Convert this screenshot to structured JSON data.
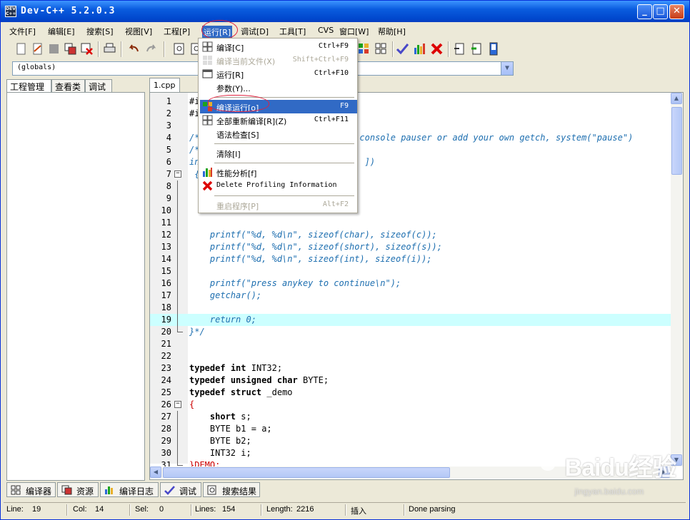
{
  "window": {
    "title": "Dev-C++ 5.2.0.3",
    "icon_text": "DEV C++"
  },
  "menubar": [
    "文件[F]",
    "编辑[E]",
    "搜索[S]",
    "视图[V]",
    "工程[P]",
    "运行[R]",
    "调试[D]",
    "工具[T]",
    "CVS",
    "窗口[W]",
    "帮助[H]"
  ],
  "active_menu": "运行[R]",
  "scope_combo": {
    "value": "(globals)"
  },
  "left_tabs": [
    "工程管理",
    "查看类",
    "调试"
  ],
  "editor_tab": "1.cpp",
  "code_lines": [
    {
      "n": "1",
      "text": "#i"
    },
    {
      "n": "2",
      "text": "#i"
    },
    {
      "n": "3",
      "text": ""
    },
    {
      "n": "4",
      "text": "/*                               console pauser or add your own getch, system(\"pause\")"
    },
    {
      "n": "5",
      "text": "/*"
    },
    {
      "n": "6",
      "text": "in                                ])"
    },
    {
      "n": "7",
      "text": " {"
    },
    {
      "n": "8",
      "text": ""
    },
    {
      "n": "9",
      "text": ""
    },
    {
      "n": "10",
      "text": ""
    },
    {
      "n": "11",
      "text": ""
    },
    {
      "n": "12",
      "text": "    printf(\"%d, %d\\n\", sizeof(char), sizeof(c));"
    },
    {
      "n": "13",
      "text": "    printf(\"%d, %d\\n\", sizeof(short), sizeof(s));"
    },
    {
      "n": "14",
      "text": "    printf(\"%d, %d\\n\", sizeof(int), sizeof(i));"
    },
    {
      "n": "15",
      "text": ""
    },
    {
      "n": "16",
      "text": "    printf(\"press anykey to continue\\n\");"
    },
    {
      "n": "17",
      "text": "    getchar();"
    },
    {
      "n": "18",
      "text": ""
    },
    {
      "n": "19",
      "text": "    return 0;"
    },
    {
      "n": "20",
      "text": "}*/"
    },
    {
      "n": "21",
      "text": ""
    },
    {
      "n": "22",
      "text": ""
    },
    {
      "n": "23",
      "text": "typedef int INT32;"
    },
    {
      "n": "24",
      "text": "typedef unsigned char BYTE;"
    },
    {
      "n": "25",
      "text": "typedef struct _demo"
    },
    {
      "n": "26",
      "text": "{"
    },
    {
      "n": "27",
      "text": "    short s;"
    },
    {
      "n": "28",
      "text": "    BYTE b1 = a;"
    },
    {
      "n": "29",
      "text": "    BYTE b2;"
    },
    {
      "n": "30",
      "text": "    INT32 i;"
    },
    {
      "n": "31",
      "text": "}DEMO;"
    }
  ],
  "run_menu": [
    {
      "label": "编译[C]",
      "shortcut": "Ctrl+F9",
      "icon": "compile-icon",
      "disabled": false
    },
    {
      "label": "编译当前文件(X)",
      "shortcut": "Shift+Ctrl+F9",
      "icon": "compile-file-icon",
      "disabled": true
    },
    {
      "label": "运行[R]",
      "shortcut": "Ctrl+F10",
      "icon": "run-icon",
      "disabled": false
    },
    {
      "label": "参数(Y)...",
      "shortcut": "",
      "icon": "",
      "disabled": false
    },
    {
      "label": "编译运行[o]",
      "shortcut": "F9",
      "icon": "compile-run-icon",
      "disabled": false,
      "selected": true
    },
    {
      "label": "全部重新编译[R](Z)",
      "shortcut": "Ctrl+F11",
      "icon": "rebuild-all-icon",
      "disabled": false
    },
    {
      "label": "语法检查[S]",
      "shortcut": "",
      "icon": "",
      "disabled": false
    },
    {
      "label": "清除[l]",
      "shortcut": "",
      "icon": "",
      "disabled": false
    },
    {
      "label": "性能分析[f]",
      "shortcut": "",
      "icon": "profile-icon",
      "disabled": false
    },
    {
      "label": "Delete Profiling Information",
      "shortcut": "",
      "icon": "delete-icon",
      "disabled": false
    },
    {
      "label": "重启程序[P]",
      "shortcut": "Alt+F2",
      "icon": "",
      "disabled": true
    }
  ],
  "bottom_tabs": [
    {
      "label": "编译器",
      "icon": "compiler-icon"
    },
    {
      "label": "资源",
      "icon": "resources-icon"
    },
    {
      "label": "编译日志",
      "icon": "compile-log-icon"
    },
    {
      "label": "调试",
      "icon": "debug-icon"
    },
    {
      "label": "搜索结果",
      "icon": "search-results-icon"
    }
  ],
  "status": {
    "line_label": "Line:",
    "line": "19",
    "col_label": "Col:",
    "col": "14",
    "sel_label": "Sel:",
    "sel": "0",
    "lines_label": "Lines:",
    "lines": "154",
    "length_label": "Length:",
    "length": "2216",
    "mode": "插入",
    "message": "Done parsing"
  },
  "watermark": {
    "brand": "Baidu经验",
    "url": "jingyan.baidu.com"
  },
  "colors": {
    "title_bar": "#0a5cdf",
    "menu_highlight": "#316ac5",
    "current_line": "#ccffff",
    "comment": "#1e6fb0",
    "annotation": "#e0213e"
  }
}
